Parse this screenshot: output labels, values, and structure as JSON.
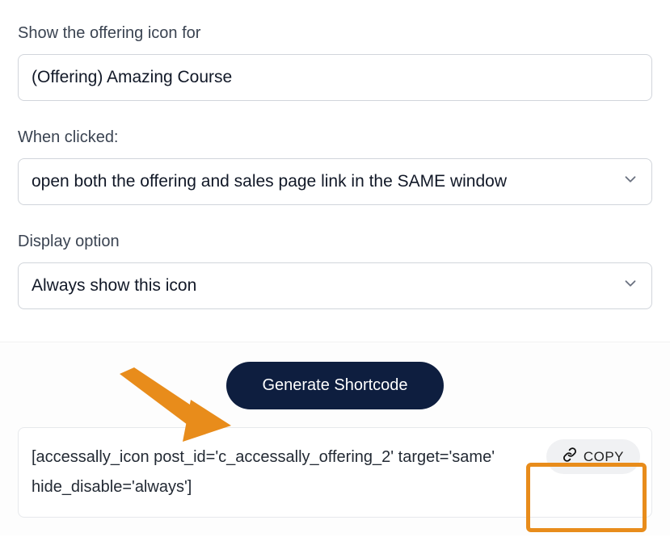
{
  "form": {
    "offering_label": "Show the offering icon for",
    "offering_value": "(Offering) Amazing Course",
    "when_clicked_label": "When clicked:",
    "when_clicked_value": "open both the offering and sales page link in the SAME window",
    "display_option_label": "Display option",
    "display_option_value": "Always show this icon"
  },
  "generate_label": "Generate Shortcode",
  "shortcode_text": "[accessally_icon post_id='c_accessally_offering_2' target='same' hide_disable='always']",
  "copy_label": "COPY",
  "annotation": {
    "arrow_color": "#e88c1b",
    "highlight_color": "#e88c1b"
  }
}
